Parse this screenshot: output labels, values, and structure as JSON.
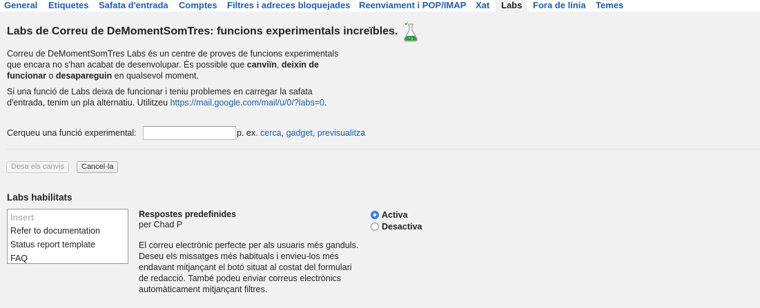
{
  "tabs": [
    {
      "label": "General"
    },
    {
      "label": "Etiquetes"
    },
    {
      "label": "Safata d'entrada"
    },
    {
      "label": "Comptes"
    },
    {
      "label": "Filtres i adreces bloquejades"
    },
    {
      "label": "Reenviament i POP/IMAP"
    },
    {
      "label": "Xat"
    },
    {
      "label": "Labs",
      "active": true
    },
    {
      "label": "Fora de línia"
    },
    {
      "label": "Temes"
    }
  ],
  "header": {
    "title": "Labs de Correu de DeMomentSomTres: funcions experimentals increïbles.",
    "icon": "flask-icon"
  },
  "intro": {
    "p1_start": "Correu de DeMomentSomTres Labs és un centre de proves de funcions experimentals que encara no s'han acabat de desenvolupar. És possible que ",
    "p1_b1": "canviïn",
    "p1_sep1": ", ",
    "p1_b2": "deixin de funcionar",
    "p1_sep2": " o ",
    "p1_b3": "desapareguin",
    "p1_end": " en qualsevol moment.",
    "p2_start": "Si una funció de Labs deixa de funcionar i teniu problemes en carregar la safata d'entrada, tenim un pla alternatiu. Utilitzeu ",
    "p2_link": "https://mail.google.com/mail/u/0/?labs=0",
    "p2_end": "."
  },
  "search": {
    "label": "Cerqueu una funció experimental:",
    "value": "",
    "examples_prefix": "p. ex. ",
    "examples": [
      "cerca",
      "gadget",
      "previsualitza"
    ],
    "sep": ", "
  },
  "buttons": {
    "save": "Desa els canvis",
    "cancel": "Cancel·la"
  },
  "enabled_labs": {
    "section_title": "Labs habilitats",
    "list": {
      "header": "Insert",
      "options": [
        "Refer to documentation",
        "Status report template",
        "FAQ"
      ]
    },
    "lab": {
      "name": "Respostes predefinides",
      "author": "per Chad P",
      "description": "El correu electrònic perfecte per als usuaris més ganduls. Deseu els missatges més habituals i envieu-los més endavant mitjançant el botó situat al costat del formulari de redacció. També podeu enviar correus electrònics automàticament mitjançant filtres."
    },
    "radio": {
      "on": "Activa",
      "off": "Desactiva",
      "selected": "on"
    }
  },
  "colors": {
    "link": "#1a5fb4",
    "background": "#f1f1f1",
    "radio_checked": "#3b83ea"
  }
}
